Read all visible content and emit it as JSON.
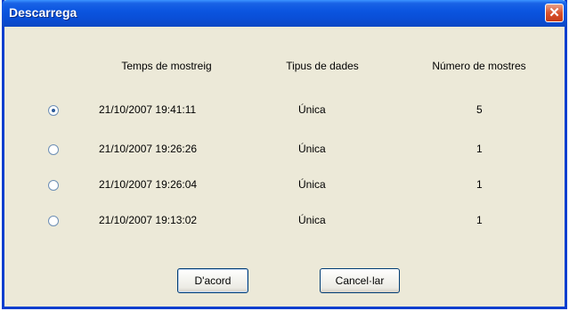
{
  "window": {
    "title": "Descarrega",
    "close_glyph": "✕"
  },
  "headers": [
    "Temps de mostreig",
    "Tipus de dades",
    "Número de mostres"
  ],
  "rows": [
    {
      "selected": true,
      "time": "21/10/2007 19:41:11",
      "type": "Única",
      "count": "5"
    },
    {
      "selected": false,
      "time": "21/10/2007 19:26:26",
      "type": "Única",
      "count": "1"
    },
    {
      "selected": false,
      "time": "21/10/2007 19:26:04",
      "type": "Única",
      "count": "1"
    },
    {
      "selected": false,
      "time": "21/10/2007 19:13:02",
      "type": "Única",
      "count": "1"
    }
  ],
  "buttons": {
    "ok": "D'acord",
    "cancel": "Cancel·lar"
  }
}
